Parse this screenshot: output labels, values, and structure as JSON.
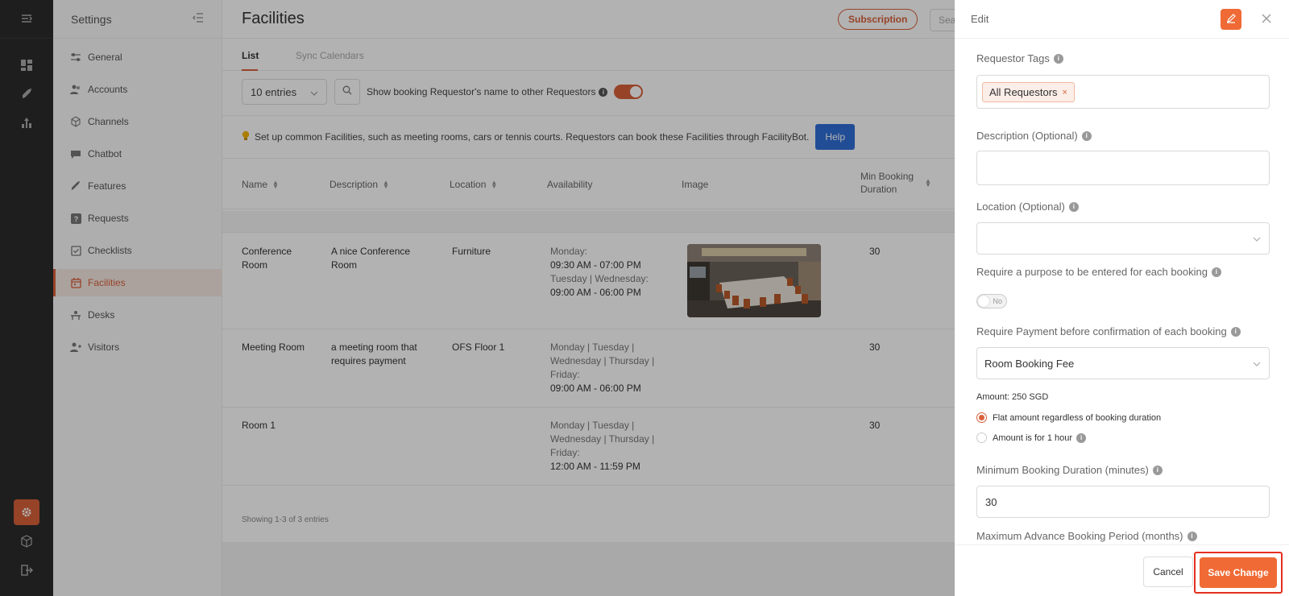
{
  "sidebar": {
    "title": "Settings",
    "items": [
      {
        "label": "General",
        "icon": "sliders-icon"
      },
      {
        "label": "Accounts",
        "icon": "users-icon"
      },
      {
        "label": "Channels",
        "icon": "cube-icon"
      },
      {
        "label": "Chatbot",
        "icon": "chat-icon"
      },
      {
        "label": "Features",
        "icon": "rocket-icon"
      },
      {
        "label": "Requests",
        "icon": "question-icon"
      },
      {
        "label": "Checklists",
        "icon": "checklist-icon"
      },
      {
        "label": "Facilities",
        "icon": "calendar-icon"
      },
      {
        "label": "Desks",
        "icon": "desk-icon"
      },
      {
        "label": "Visitors",
        "icon": "visitor-icon"
      }
    ],
    "active": "Facilities"
  },
  "header": {
    "title": "Facilities",
    "subscription_label": "Subscription",
    "search_placeholder": "Sear"
  },
  "tabs": [
    "List",
    "Sync Calendars"
  ],
  "toolbar": {
    "entries_value": "10 entries",
    "show_label": "Show booking Requestor's name to other Requestors",
    "toggle_on": true
  },
  "tip": {
    "text": "Set up common Facilities, such as meeting rooms, cars or tennis courts. Requestors can book these Facilities through FacilityBot.",
    "help_label": "Help"
  },
  "table": {
    "columns": [
      "Name",
      "Description",
      "Location",
      "Availability",
      "Image",
      "Min Booking",
      "Duration"
    ],
    "rows": [
      {
        "name1": "Conference",
        "name2": "Room",
        "desc1": "A nice Conference",
        "desc2": "Room",
        "location": "Furniture",
        "av1": "Monday:",
        "av2": "09:30 AM - 07:00 PM",
        "av3": "Tuesday | Wednesday:",
        "av4": "09:00 AM - 06:00 PM",
        "min": "30"
      },
      {
        "name1": "Meeting Room",
        "name2": "",
        "desc1": "a meeting room that",
        "desc2": "requires payment",
        "location": "OFS Floor 1",
        "av1": "Monday | Tuesday |",
        "av2": "Wednesday | Thursday |",
        "av3": "Friday:",
        "av4": "09:00 AM - 06:00 PM",
        "min": "30"
      },
      {
        "name1": "Room 1",
        "name2": "",
        "desc1": "",
        "desc2": "",
        "location": "",
        "av1": "Monday | Tuesday |",
        "av2": "Wednesday | Thursday |",
        "av3": "Friday:",
        "av4": "12:00 AM - 11:59 PM",
        "min": "30"
      }
    ],
    "showing": "Showing 1-3 of 3 entries"
  },
  "panel": {
    "title": "Edit",
    "requestor_tags_label": "Requestor Tags",
    "tag": "All Requestors",
    "description_label": "Description (Optional)",
    "location_label": "Location (Optional)",
    "purpose_label": "Require a purpose to be entered for each booking",
    "purpose_toggle": "No",
    "payment_label": "Require Payment before confirmation of each booking",
    "payment_value": "Room Booking Fee",
    "amount": "Amount: 250 SGD",
    "radio_flat": "Flat amount regardless of booking duration",
    "radio_hour": "Amount is for 1 hour",
    "min_duration_label": "Minimum Booking Duration (minutes)",
    "min_duration_value": "30",
    "max_advance_label": "Maximum Advance Booking Period (months)",
    "cancel_label": "Cancel",
    "save_label": "Save Change"
  },
  "colors": {
    "accent": "#f06a35",
    "rail": "#2b2b2b",
    "help": "#2f6fd6",
    "highlight": "#e5301f"
  }
}
